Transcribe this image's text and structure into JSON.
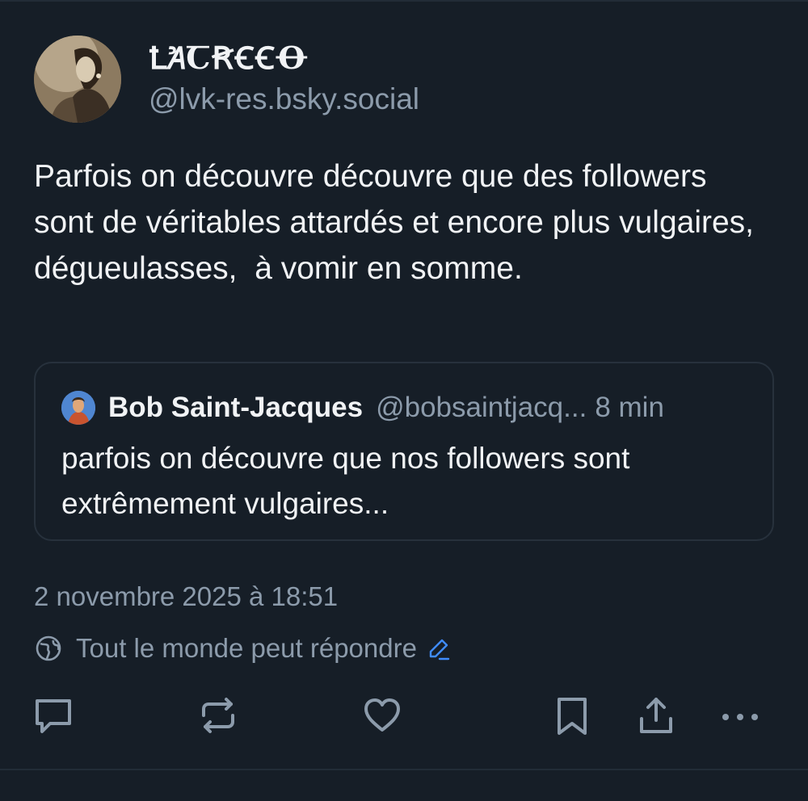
{
  "author": {
    "display_name": "ꝈꞺꞆꞦꞒꞒꝊ",
    "display_name_plain": "LUCRECO",
    "handle": "@lvk-res.bsky.social"
  },
  "post": {
    "text": "Parfois on découvre découvre que des followers sont de véritables attardés et encore plus vulgaires,  dégueulasses,  à vomir en somme.",
    "timestamp": "2 novembre 2025 à 18:51",
    "reply_setting": "Tout le monde peut répondre"
  },
  "quote": {
    "name": "Bob Saint-Jacques",
    "handle": "@bobsaintjacq...",
    "time": "8 min",
    "text": "parfois on découvre que nos followers sont extrêmement vulgaires..."
  },
  "icons": {
    "reply": "comment-icon",
    "repost": "repost-icon",
    "like": "heart-icon",
    "bookmark": "bookmark-icon",
    "share": "share-icon",
    "more": "more-icon",
    "globe": "globe-icon",
    "edit": "pencil-icon"
  },
  "colors": {
    "background": "#161e27",
    "text": "#f1f3f5",
    "muted": "#8c9bab",
    "accent": "#3f8cff",
    "border": "#27313c"
  }
}
